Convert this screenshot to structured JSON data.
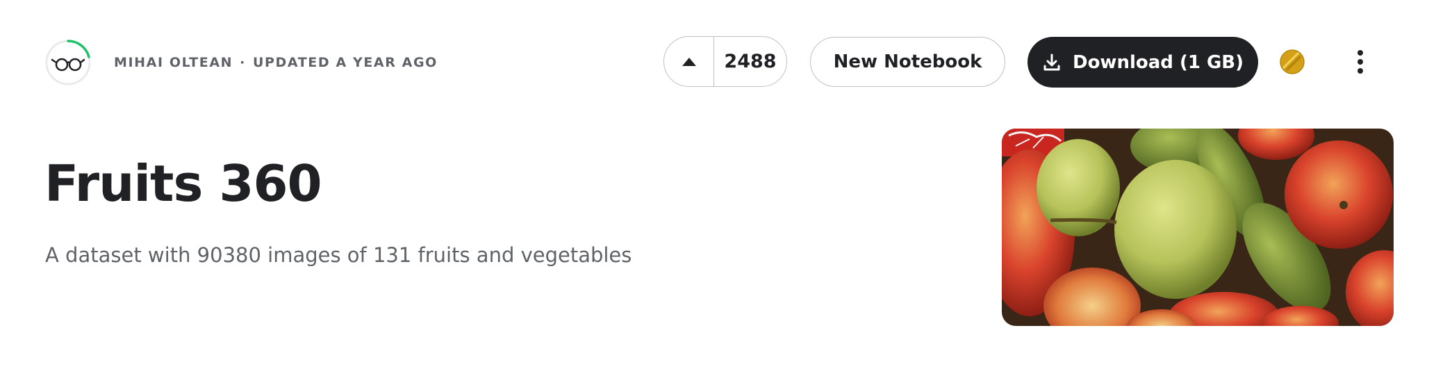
{
  "header": {
    "owner": "MIHAI OLTEAN",
    "separator": "·",
    "updated": "UPDATED A YEAR AGO",
    "upvote_count": "2488",
    "new_notebook_label": "New Notebook",
    "download_label": "Download (1 GB)"
  },
  "dataset": {
    "title": "Fruits 360",
    "subtitle": "A dataset with 90380 images of 131 fruits and vegetables"
  },
  "icons": {
    "avatar": "glasses-avatar-icon",
    "upvote": "caret-up-icon",
    "download": "download-icon",
    "medal": "gold-medal-icon",
    "more": "more-vertical-icon"
  },
  "colors": {
    "text_primary": "#202124",
    "text_secondary": "#5f6368",
    "border": "#bdc1c6",
    "download_bg": "#202124",
    "progress_ring": "#20BEFF",
    "progress_green": "#1fc16b",
    "medal_gold": "#d4a017"
  }
}
